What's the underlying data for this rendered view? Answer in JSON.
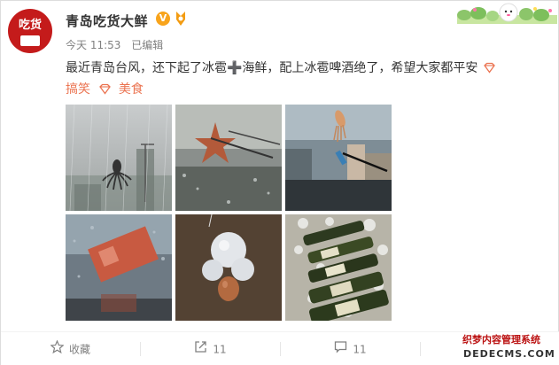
{
  "post": {
    "nickname": "青岛吃货大鲜",
    "verified_badge": "V",
    "time": "今天 11:53",
    "edited": "已编辑",
    "text": "最近青岛台风，还下起了冰雹➕海鲜，配上冰雹啤酒绝了，希望大家都平安",
    "topics": [
      "搞笑",
      "美食"
    ]
  },
  "images": [
    {
      "name": "octopus-in-rain-image"
    },
    {
      "name": "starfish-on-windshield-image"
    },
    {
      "name": "squid-on-windshield-image"
    },
    {
      "name": "banknote-on-window-image"
    },
    {
      "name": "hailstones-and-egg-image"
    },
    {
      "name": "beer-bottles-in-hail-image"
    }
  ],
  "actions": {
    "favorite": "收藏",
    "repost": "11",
    "comment": "11"
  },
  "watermark": {
    "line1": "织梦内容管理系统",
    "line2": "DEDECMS.COM"
  },
  "colors": {
    "topic": "#eb7350",
    "meta": "#808080",
    "verified": "#f8a41c"
  }
}
